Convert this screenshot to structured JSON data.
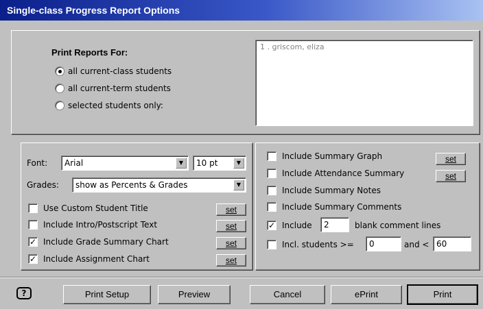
{
  "window": {
    "title": "Single-class Progress Report Options"
  },
  "print_for": {
    "heading": "Print Reports For:",
    "options": [
      {
        "label": "all current-class students",
        "selected": true
      },
      {
        "label": "all current-term students",
        "selected": false
      },
      {
        "label": "selected students only:",
        "selected": false
      }
    ],
    "student_list": [
      "1 . griscom, eliza"
    ]
  },
  "left": {
    "font_label": "Font:",
    "font_value": "Arial",
    "size_value": "10 pt",
    "grades_label": "Grades:",
    "grades_value": "show as Percents & Grades",
    "set_label": "set",
    "options": [
      {
        "label": "Use Custom Student Title",
        "checked": false
      },
      {
        "label": "Include Intro/Postscript Text",
        "checked": false
      },
      {
        "label": "Include Grade Summary Chart",
        "checked": true
      },
      {
        "label": "Include Assignment Chart",
        "checked": true
      }
    ]
  },
  "right": {
    "set_label": "set",
    "options": [
      {
        "label": "Include Summary Graph",
        "checked": false
      },
      {
        "label": "Include Attendance Summary",
        "checked": false
      },
      {
        "label": "Include Summary Notes",
        "checked": false
      },
      {
        "label": "Include Summary Comments",
        "checked": false
      }
    ],
    "blank_lines": {
      "checked": true,
      "prefix": "Include",
      "value": "2",
      "suffix": "blank comment lines"
    },
    "incl_students": {
      "checked": false,
      "prefix": "Incl. students >=",
      "min": "0",
      "middle": "and <",
      "max": "60"
    }
  },
  "footer": {
    "help_icon": "?",
    "buttons": {
      "print_setup": "Print Setup",
      "preview": "Preview",
      "cancel": "Cancel",
      "eprint": "ePrint",
      "print": "Print"
    }
  }
}
